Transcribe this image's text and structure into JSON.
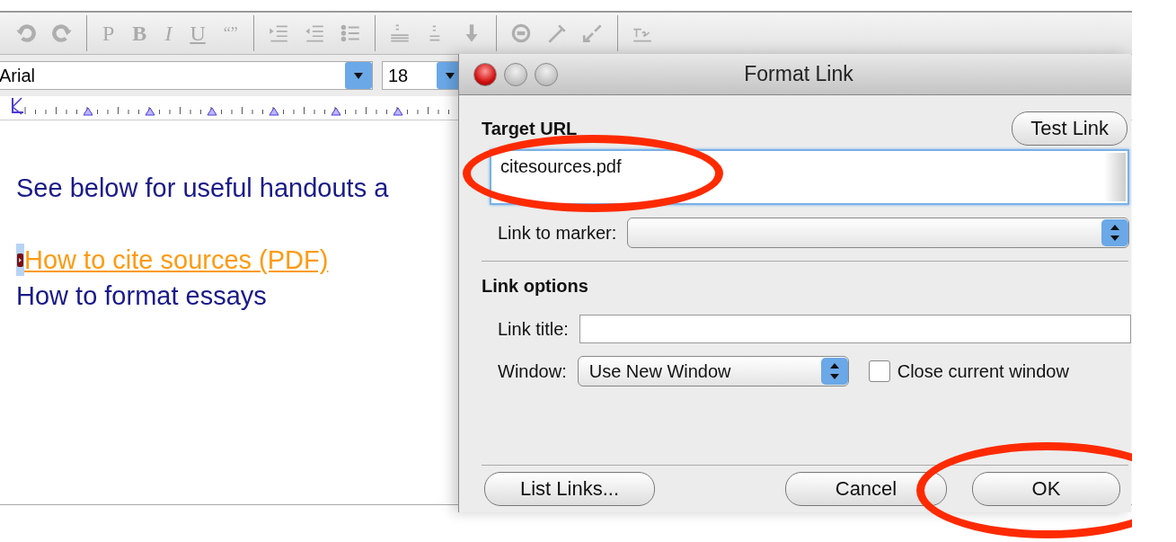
{
  "toolbar": {
    "text_buttons": [
      "P",
      "B",
      "I",
      "U",
      "“”"
    ],
    "disabled": true
  },
  "font_bar": {
    "font": "Arial",
    "size": "18"
  },
  "document": {
    "paragraphs": [
      {
        "kind": "text",
        "text": "See below for useful handouts a"
      },
      {
        "kind": "gap"
      },
      {
        "kind": "link",
        "text": "How to cite sources (PDF)",
        "selected": true
      },
      {
        "kind": "text",
        "text": "How to format essays"
      }
    ]
  },
  "dialog": {
    "title": "Format Link",
    "target_label": "Target URL",
    "test_button": "Test Link",
    "url_field": {
      "value": "citesources.pdf",
      "highlighted": true
    },
    "marker_label": "Link to marker:",
    "options_heading": "Link options",
    "title_label": "Link title:",
    "window_label": "Window:",
    "window_value": "Use New Window",
    "close_checkbox": {
      "label": "Close current window",
      "checked": false
    },
    "buttons": [
      {
        "label": "List Links...",
        "highlighted": false
      },
      {
        "label": "Cancel",
        "highlighted": false
      },
      {
        "label": "OK",
        "highlighted": true
      }
    ]
  }
}
